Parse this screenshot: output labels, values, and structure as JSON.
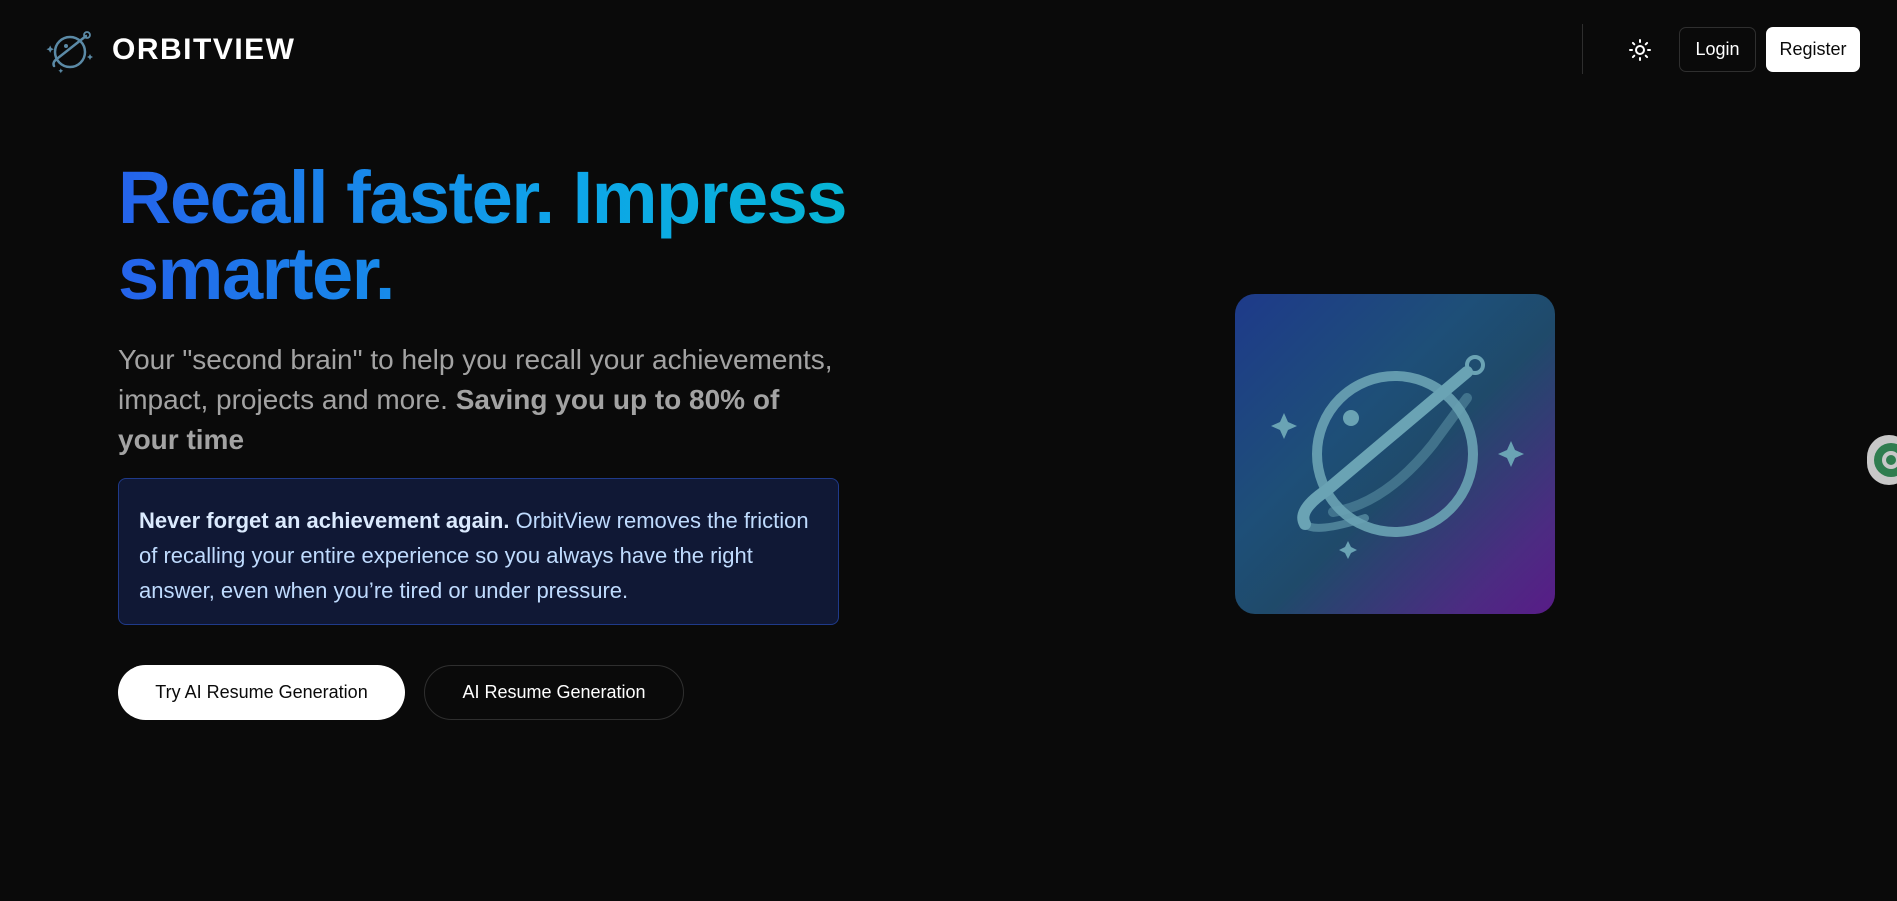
{
  "header": {
    "brand_name": "ORBITVIEW",
    "login_label": "Login",
    "register_label": "Register",
    "theme_icon": "sun-icon"
  },
  "hero": {
    "title": "Recall faster. Impress smarter.",
    "subtitle_plain": "Your \"second brain\" to help you recall your achievements, impact, projects and more. ",
    "subtitle_bold": "Saving you up to 80% of your time",
    "callout_bold": "Never forget an achievement again.",
    "callout_text": " OrbitView removes the friction of recalling your entire experience so you always have the right answer, even when you’re tired or under pressure.",
    "primary_button": "Try AI Resume Generation",
    "secondary_button": "AI Resume Generation",
    "illustration_icon": "planet-icon"
  },
  "colors": {
    "background": "#0a0a0a",
    "title_gradient_start": "#2563eb",
    "title_gradient_end": "#06b6d4",
    "callout_bg": "#101835",
    "callout_border": "#1f3a8a"
  }
}
